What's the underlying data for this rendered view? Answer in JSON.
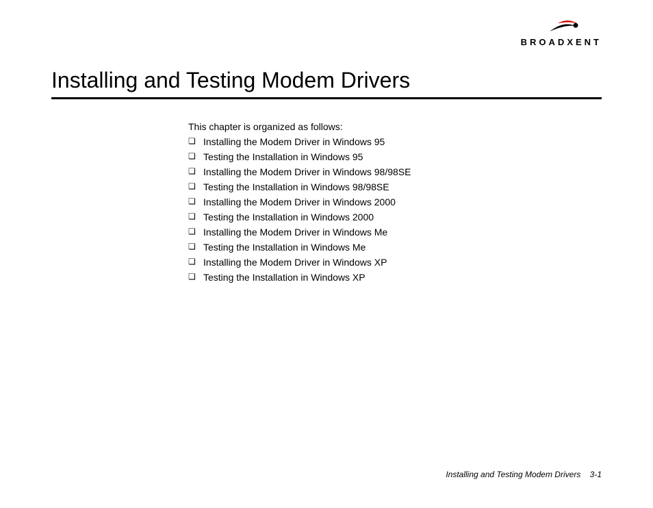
{
  "logo": {
    "brand_text": "BROADXENT"
  },
  "title": "Installing and Testing Modem Drivers",
  "intro": "This chapter is organized as follows:",
  "items": [
    "Installing the Modem Driver in Windows 95",
    "Testing the Installation in Windows 95",
    "Installing the Modem Driver in Windows 98/98SE",
    "Testing the Installation in Windows 98/98SE",
    "Installing the Modem Driver in Windows 2000",
    "Testing the Installation in Windows 2000",
    "Installing the Modem Driver in Windows Me",
    "Testing the Installation in Windows Me",
    "Installing the Modem Driver in Windows XP",
    "Testing the Installation in Windows XP"
  ],
  "footer": {
    "section": "Installing and Testing Modem Drivers",
    "page": "3-1"
  }
}
